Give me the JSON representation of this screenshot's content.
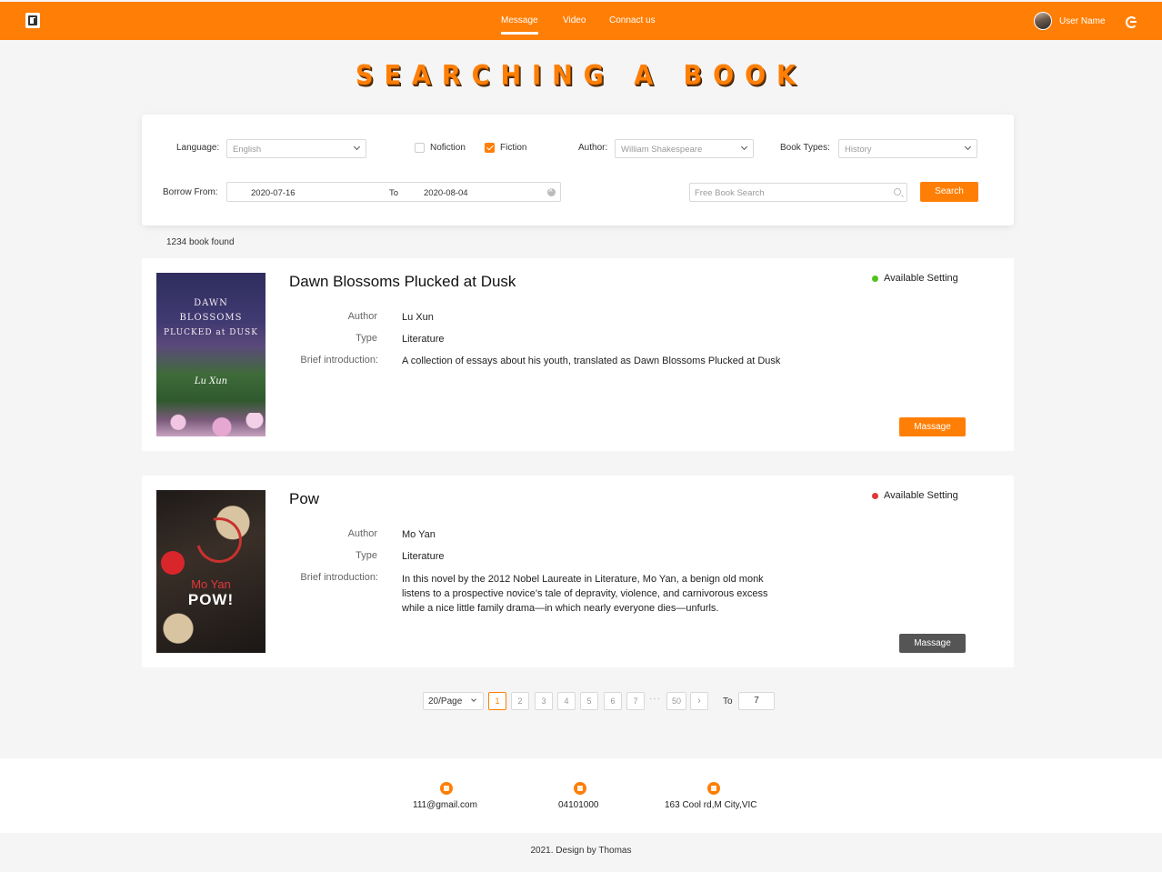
{
  "header": {
    "nav": [
      "Message",
      "Video",
      "Connact us"
    ],
    "user_name": "User Name"
  },
  "page_title": "SEARCHING A BOOK",
  "filters": {
    "language_label": "Language:",
    "language_value": "English",
    "nonfiction_label": "Nofiction",
    "nonfiction_checked": false,
    "fiction_label": "Fiction",
    "fiction_checked": true,
    "author_label": "Author:",
    "author_value": "William Shakespeare",
    "book_types_label": "Book Types:",
    "book_types_value": "History",
    "borrow_from_label": "Borrow From:",
    "date_from": "2020-07-16",
    "date_to_label": "To",
    "date_to": "2020-08-04",
    "search_placeholder": "Free Book Search",
    "search_button": "Search"
  },
  "results_count": "1234 book found",
  "field_labels": {
    "author": "Author",
    "type": "Type",
    "intro": "Brief introduction:"
  },
  "books": [
    {
      "title": "Dawn Blossoms Plucked at Dusk",
      "status": "Available Setting",
      "status_color": "#52c41a",
      "author": "Lu Xun",
      "type": "Literature",
      "intro": "A collection of essays about his youth, translated as Dawn Blossoms Plucked at Dusk",
      "button": "Massage",
      "button_color": "#ff7f06",
      "cover_lines": [
        "DAWN",
        "BLOSSOMS",
        "PLUCKED at DUSK"
      ],
      "cover_author": "Lu Xun"
    },
    {
      "title": "Pow",
      "status": "Available Setting",
      "status_color": "#e0383a",
      "author": "Mo Yan",
      "type": "Literature",
      "intro_lines": [
        "In this novel by the 2012 Nobel Laureate in Literature, Mo Yan, a benign old monk",
        "listens to a prospective novice’s tale of depravity, violence, and carnivorous excess",
        "while a nice little family drama—in which nearly everyone dies—unfurls."
      ],
      "button": "Massage",
      "button_color": "#555555",
      "cover_author": "Mo Yan",
      "cover_title": "POW!"
    }
  ],
  "pagination": {
    "page_size": "20/Page",
    "pages": [
      "1",
      "2",
      "3",
      "4",
      "5",
      "6",
      "7"
    ],
    "current_page": "1",
    "ellipsis": "···",
    "last_page": "50",
    "next": "›",
    "jump_label": "To",
    "jump_value": "7"
  },
  "footer": {
    "email": "111@gmail.com",
    "phone": "04101000",
    "address": "163 Cool rd,M City,VIC",
    "copyright": "2021. Design by Thomas"
  },
  "colors": {
    "accent": "#ff7f06"
  }
}
